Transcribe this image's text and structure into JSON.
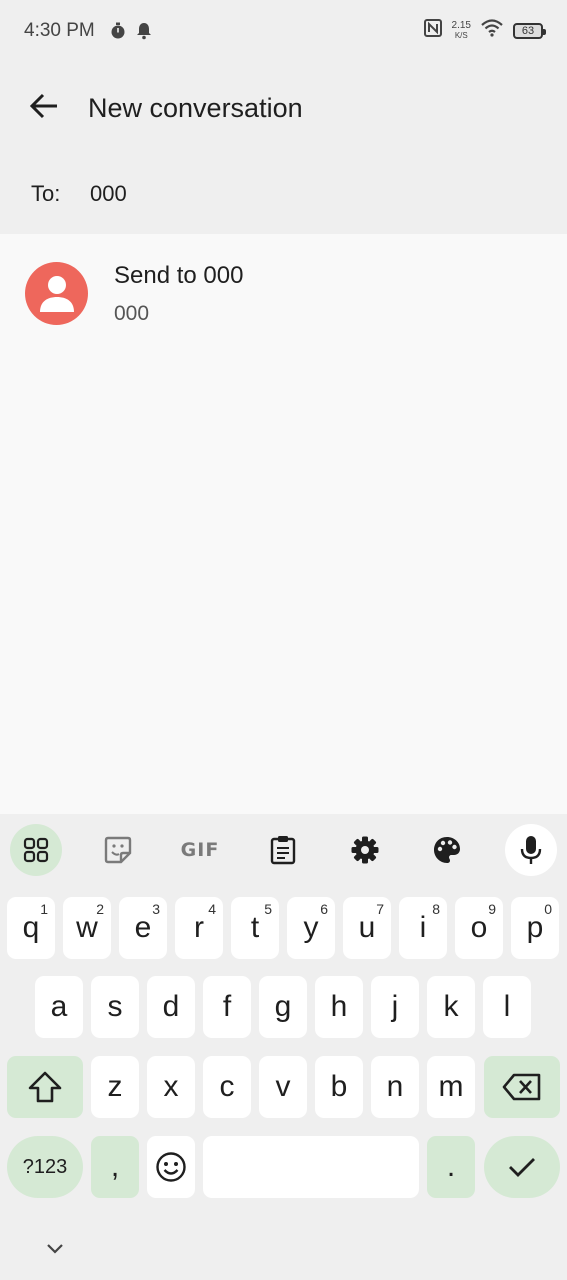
{
  "status_bar": {
    "time": "4:30 PM",
    "net_speed_value": "2.15",
    "net_speed_unit": "K/S",
    "battery": "63",
    "icons": [
      "timer-icon",
      "notification-bell-icon",
      "nfc-icon",
      "wifi-icon",
      "battery-icon"
    ]
  },
  "app_bar": {
    "title": "New conversation",
    "back_icon": "arrow-back-icon"
  },
  "recipient": {
    "label": "To:",
    "value": "000"
  },
  "suggestion": {
    "primary": "Send to 000",
    "secondary": "000",
    "avatar_color": "#ee675c"
  },
  "keyboard": {
    "toolbar": [
      "apps-grid-icon",
      "sticker-icon",
      "gif-icon",
      "clipboard-icon",
      "settings-gear-icon",
      "palette-icon",
      "microphone-icon"
    ],
    "gif_label": "GIF",
    "row1": [
      {
        "k": "q",
        "h": "1"
      },
      {
        "k": "w",
        "h": "2"
      },
      {
        "k": "e",
        "h": "3"
      },
      {
        "k": "r",
        "h": "4"
      },
      {
        "k": "t",
        "h": "5"
      },
      {
        "k": "y",
        "h": "6"
      },
      {
        "k": "u",
        "h": "7"
      },
      {
        "k": "i",
        "h": "8"
      },
      {
        "k": "o",
        "h": "9"
      },
      {
        "k": "p",
        "h": "0"
      }
    ],
    "row2": [
      "a",
      "s",
      "d",
      "f",
      "g",
      "h",
      "j",
      "k",
      "l"
    ],
    "row3": [
      "z",
      "x",
      "c",
      "v",
      "b",
      "n",
      "m"
    ],
    "symbols_key": "?123",
    "comma_key": ",",
    "period_key": ".",
    "accent_color": "#d5e9d4"
  }
}
